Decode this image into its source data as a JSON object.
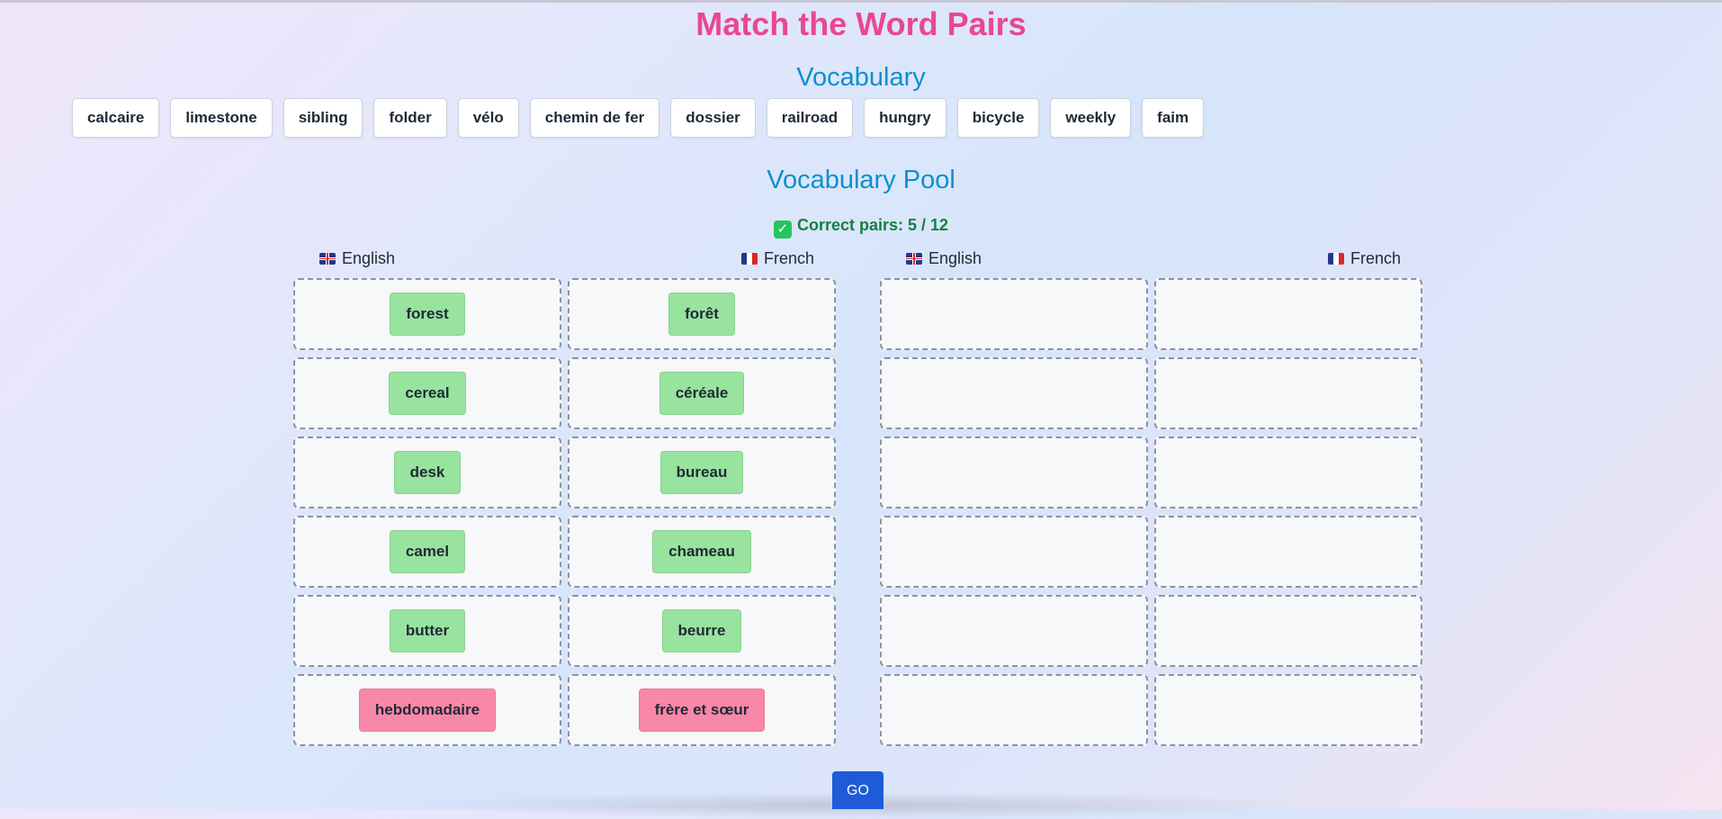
{
  "title": "Match the Word Pairs",
  "vocabulary_heading": "Vocabulary",
  "vocabulary": [
    "calcaire",
    "limestone",
    "sibling",
    "folder",
    "vélo",
    "chemin de fer",
    "dossier",
    "railroad",
    "hungry",
    "bicycle",
    "weekly",
    "faim"
  ],
  "pool_heading": "Vocabulary Pool",
  "status": {
    "label": "Correct pairs: 5 / 12",
    "correct": 5,
    "total": 12
  },
  "columns": {
    "english": "English",
    "french": "French"
  },
  "left_board": [
    {
      "en": "forest",
      "fr": "forêt",
      "state": "correct"
    },
    {
      "en": "cereal",
      "fr": "céréale",
      "state": "correct"
    },
    {
      "en": "desk",
      "fr": "bureau",
      "state": "correct"
    },
    {
      "en": "camel",
      "fr": "chameau",
      "state": "correct"
    },
    {
      "en": "butter",
      "fr": "beurre",
      "state": "correct"
    },
    {
      "en": "hebdomadaire",
      "fr": "frère et sœur",
      "state": "incorrect"
    }
  ],
  "right_board_rows": 6,
  "go_label": "GO",
  "colors": {
    "title": "#e8488f",
    "heading": "#0b8fd0",
    "correct": "#98e39d",
    "incorrect": "#f988a8",
    "go": "#1d5bd8"
  }
}
